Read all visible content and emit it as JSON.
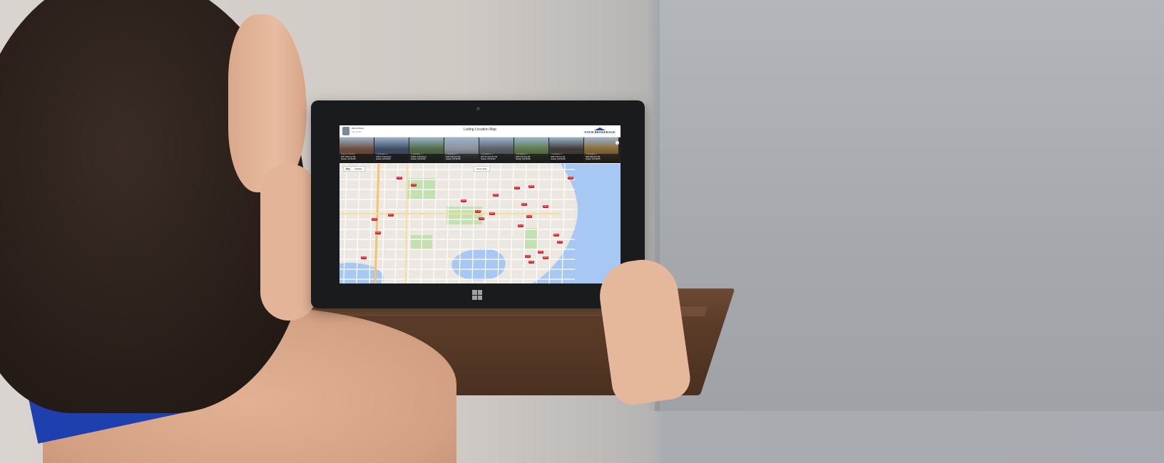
{
  "app": {
    "title": "Listing Location Map",
    "brand": "YOUR BROKERAGE",
    "agent_name": "Maria Wilson",
    "agent_subtitle": "Sunn Realty",
    "next_symbol": "›",
    "zoom_symbols": [
      "+",
      "−"
    ]
  },
  "map_controls": {
    "map_label": "Map",
    "satellite_label": "Satellite",
    "mode_button": "Street Map"
  },
  "listings": [
    {
      "status": "SUBJECT PROPERTY",
      "address": "2227 46th Ave NE",
      "city": "Seattle, WA 98105",
      "color": "#6d4c3b"
    },
    {
      "status": "COMPARABLE #1",
      "address": "10619 Undisclosed",
      "city": "Seattle, WA 98105",
      "color": "#3c4b63"
    },
    {
      "status": "COMPARABLE #2",
      "address": "10932 Undisclosed",
      "city": "Seattle, WA 98105",
      "color": "#4f6a45"
    },
    {
      "status": "COMPARABLE #3",
      "address": "4433 12th Ave NE",
      "city": "Seattle, WA 98105",
      "color": "#8a9199"
    },
    {
      "status": "COMPARABLE #4",
      "address": "4227 E Laurel Dr NE",
      "city": "Seattle, WA 98105",
      "color": "#5a5f66"
    },
    {
      "status": "COMPARABLE #5",
      "address": "2820 47th Ave NE",
      "city": "Seattle, WA 98105",
      "color": "#5c7a4b"
    },
    {
      "status": "COMPARABLE #6",
      "address": "2926 47th Ave NE",
      "city": "Seattle, WA 98105",
      "color": "#3e3a36"
    },
    {
      "status": "COMPARABLE #7",
      "address": "3815 49th Ave NE",
      "city": "Seattle, WA 98105",
      "color": "#8a6a35"
    }
  ],
  "map_markers": [
    "$950K",
    "$1.2M",
    "$875K",
    "$1.1M",
    "$699K",
    "$1.4M",
    "$825K",
    "$1.0M",
    "$765K",
    "$1.3M",
    "$910K",
    "$1.5M",
    "$995K",
    "$1.1M",
    "$840K",
    "$1.2M",
    "$760K",
    "$1.6M",
    "$1.0M",
    "$880K",
    "$1.3M",
    "$930K",
    "$1.1M",
    "$705K"
  ],
  "colors": {
    "water": "#a7c8f2",
    "park": "#c4dfb0",
    "marker": "#d8232a",
    "brand": "#1f3a66"
  }
}
